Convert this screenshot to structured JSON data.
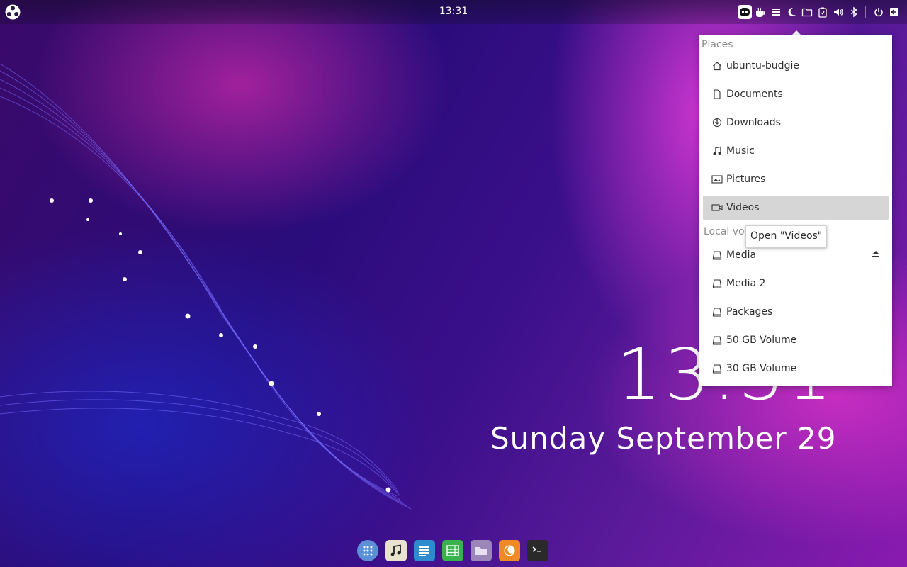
{
  "panel": {
    "time": "13:31",
    "tray_icons": [
      "budgie-indicator-icon",
      "caffeine-icon",
      "menu-lines-icon",
      "night-light-icon",
      "places-folder-icon",
      "battery-clipboard-icon",
      "volume-icon",
      "bluetooth-icon",
      "power-icon",
      "logout-icon"
    ]
  },
  "places": {
    "section_places": "Places",
    "items": [
      {
        "label": "ubuntu-budgie",
        "icon": "home-icon"
      },
      {
        "label": "Documents",
        "icon": "document-icon"
      },
      {
        "label": "Downloads",
        "icon": "download-icon"
      },
      {
        "label": "Music",
        "icon": "music-icon"
      },
      {
        "label": "Pictures",
        "icon": "pictures-icon"
      },
      {
        "label": "Videos",
        "icon": "video-icon"
      }
    ],
    "section_volumes": "Local volumes",
    "volumes": [
      {
        "label": "Media",
        "icon": "drive-icon",
        "eject": true
      },
      {
        "label": "Media 2",
        "icon": "drive-icon"
      },
      {
        "label": "Packages",
        "icon": "drive-icon"
      },
      {
        "label": "50 GB Volume",
        "icon": "drive-icon"
      },
      {
        "label": "30 GB Volume",
        "icon": "drive-icon"
      }
    ],
    "tooltip": "Open \"Videos\""
  },
  "desktop_clock": {
    "time": "13:31",
    "date": "Sunday September 29"
  },
  "dock": {
    "apps": [
      "app-grid-icon",
      "music-player-icon",
      "text-editor-icon",
      "spreadsheet-icon",
      "file-manager-icon",
      "firefox-icon",
      "terminal-icon"
    ],
    "colors": {
      "grid": "#5b8fd6",
      "music": "#e8e2cf",
      "writer": "#2e8bd0",
      "calc": "#37b24d",
      "files": "#9a86b8",
      "firefox": "#f08a24",
      "terminal": "#2a2a2a"
    }
  }
}
